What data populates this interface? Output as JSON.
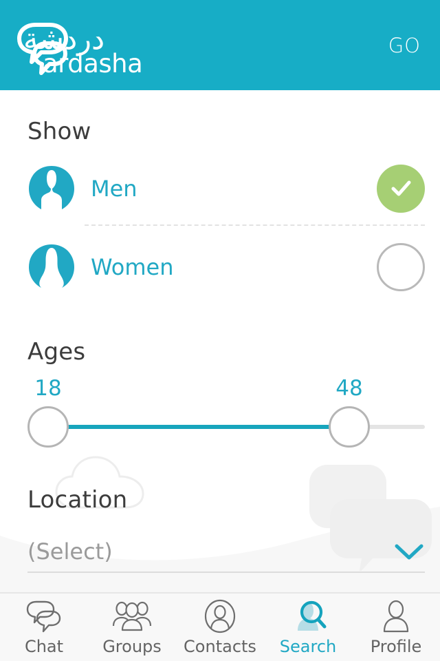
{
  "header": {
    "logo_arabic": "دردشة",
    "logo_latin": "ardasha",
    "logo_icon": "chat-bubble-icon",
    "go_label": "GO",
    "background_color": "#17adc6"
  },
  "show": {
    "title": "Show",
    "options": [
      {
        "label": "Men",
        "icon": "male-avatar-icon",
        "selected": true,
        "toggle_icon": "check-icon"
      },
      {
        "label": "Women",
        "icon": "female-avatar-icon",
        "selected": false,
        "toggle_icon": "empty-circle-icon"
      }
    ],
    "selected_color": "#a6cf74",
    "label_color": "#21a8c4"
  },
  "ages": {
    "title": "Ages",
    "min_value": "18",
    "max_value": "48",
    "range_min": 18,
    "range_max": 55,
    "track_color": "#17a5bd",
    "track_inactive_color": "#e4e4e4"
  },
  "location": {
    "title": "Location",
    "placeholder": "(Select)",
    "value": "",
    "chevron_icon": "chevron-down-icon",
    "accent_color": "#21a8c4"
  },
  "tabbar": {
    "items": [
      {
        "label": "Chat",
        "icon": "chat-bubbles-icon",
        "active": false
      },
      {
        "label": "Groups",
        "icon": "people-group-icon",
        "active": false
      },
      {
        "label": "Contacts",
        "icon": "contact-circle-icon",
        "active": false
      },
      {
        "label": "Search",
        "icon": "search-person-icon",
        "active": true
      },
      {
        "label": "Profile",
        "icon": "person-icon",
        "active": false
      }
    ],
    "active_color": "#21a8c4",
    "inactive_color": "#646464"
  }
}
